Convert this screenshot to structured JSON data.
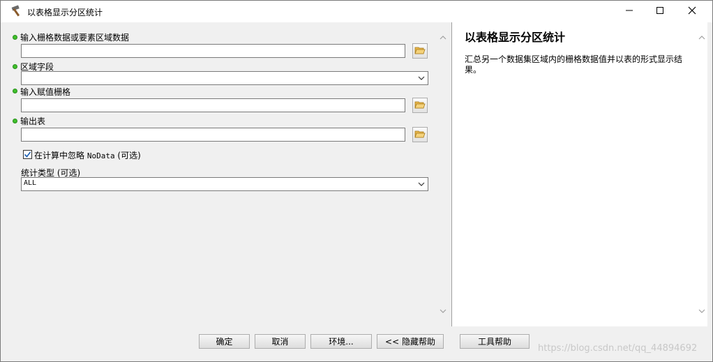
{
  "window": {
    "title": "以表格显示分区统计",
    "icons": {
      "app": "hammer-icon",
      "minimize": "minimize-icon",
      "maximize": "maximize-icon",
      "close": "close-icon"
    }
  },
  "params": {
    "input_zone": {
      "label": "输入栅格数据或要素区域数据",
      "value": "",
      "required": true
    },
    "zone_field": {
      "label": "区域字段",
      "value": "",
      "required": true
    },
    "value_raster": {
      "label": "输入赋值栅格",
      "value": "",
      "required": true
    },
    "output_table": {
      "label": "输出表",
      "value": "",
      "required": true
    },
    "ignore_nodata": {
      "label_prefix": "在计算中忽略 ",
      "label_code": "NoData",
      "label_suffix": " (可选)",
      "checked": true
    },
    "statistics_type": {
      "label": "统计类型 (可选)",
      "value": "ALL"
    }
  },
  "help": {
    "title": "以表格显示分区统计",
    "description": "汇总另一个数据集区域内的栅格数据值并以表的形式显示结果。"
  },
  "buttons": {
    "ok": "确定",
    "cancel": "取消",
    "environments": "环境...",
    "hide_help": "<< 隐藏帮助",
    "tool_help": "工具帮助"
  },
  "watermark": "https://blog.csdn.net/qq_44894692",
  "colors": {
    "required_dot": "#3fbf2b",
    "checkbox_check": "#1a5fb4"
  }
}
